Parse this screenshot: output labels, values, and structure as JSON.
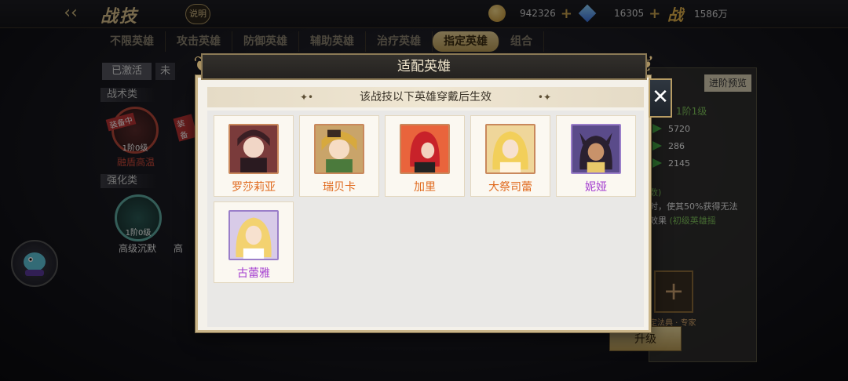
{
  "header": {
    "title": "战技",
    "help_label": "说明",
    "coins": "942326",
    "gems": "16305",
    "power_label": "战",
    "power_value": "1586万"
  },
  "tabs": [
    {
      "label": "不限英雄",
      "active": false
    },
    {
      "label": "攻击英雄",
      "active": false
    },
    {
      "label": "防御英雄",
      "active": false
    },
    {
      "label": "辅助英雄",
      "active": false
    },
    {
      "label": "治疗英雄",
      "active": false
    },
    {
      "label": "指定英雄",
      "active": true
    },
    {
      "label": "组合",
      "active": false
    }
  ],
  "left_panel": {
    "activated_label": "已激活",
    "unactivated_label": "未",
    "tactic_label": "战术类",
    "enhance_label": "强化类",
    "equipped_badge": "装备中",
    "equipped_badge2": "装备",
    "skill1_level": "1阶0级",
    "skill1_name": "融盾高温",
    "skill2_level": "1阶0级",
    "skill2_name": "高级沉默",
    "skill3_name": "高"
  },
  "right_panel": {
    "preview_label": "进阶预览",
    "level_text": "1阶1级",
    "stats": [
      "5720",
      "286",
      "2145"
    ],
    "desc_heading": "数)",
    "desc_line1": "时，使其50%获得无法",
    "desc_line2": "效果",
    "desc_link": "(初级英雄摇",
    "slot_caption": "定法典 · 专家",
    "upgrade_label": "升级"
  },
  "modal": {
    "title": "适配英雄",
    "subtitle": "该战技以下英雄穿戴后生效",
    "close_label": "✕",
    "heroes": [
      {
        "name": "罗莎莉亚",
        "rarity": "orange"
      },
      {
        "name": "瑞贝卡",
        "rarity": "orange"
      },
      {
        "name": "加里",
        "rarity": "orange"
      },
      {
        "name": "大祭司蕾",
        "rarity": "orange"
      },
      {
        "name": "妮娅",
        "rarity": "violet"
      },
      {
        "name": "古蕾雅",
        "rarity": "violet"
      }
    ]
  },
  "colors": {
    "orange_name": "#e06a1e",
    "violet_name": "#a53fd0",
    "accent_gold": "#cbb68a"
  }
}
